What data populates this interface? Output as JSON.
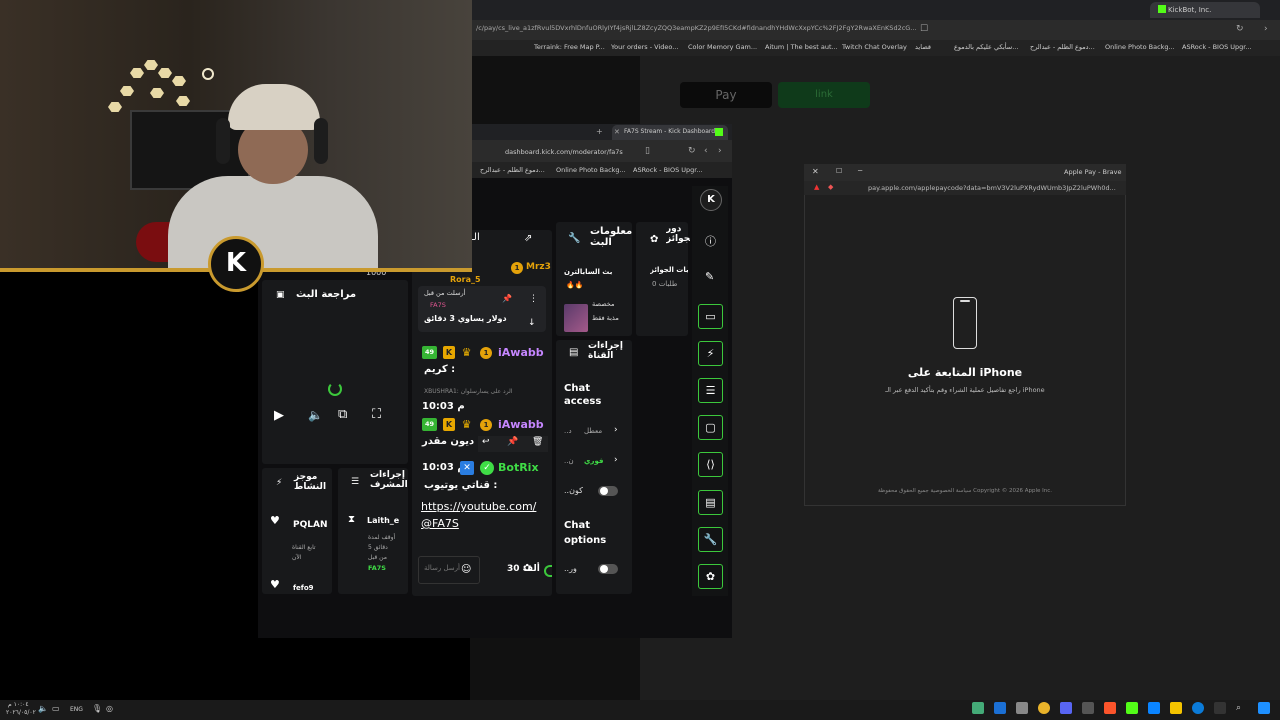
{
  "bg_browser": {
    "tab_label": "KickBot, Inc.",
    "url": "/c/pay/cs_live_a1zfRvul5DVxrhlDnfuORlyIYf4jsRjlLZ8ZcyZQQ3eampKZ2p9EfI5CKd#fidnandhYHdWcXxpYCc%2FJ2FgY2RwaXEnKSd2cG...",
    "bookmarks": [
      "Terraink: Free Map P...",
      "Your orders - Video...",
      "Color Memory Gam...",
      "Aitum | The best aut...",
      "Twitch Chat Overlay",
      "قصايد",
      "سأبكي عليكم بالدموع...",
      "دموع الظلم - عبدالرح...",
      "Online Photo Backg...",
      "ASRock - BIOS Upgr..."
    ],
    "apple_pay_label": " Pay",
    "link_label": "link"
  },
  "apple_pay_popup": {
    "title": "Apple Pay - Brave",
    "url": "pay.apple.com/applepaycode?data=bmV3V2luPXRydWUmb3JpZ2luPWh0d...",
    "heading": "المتابعة على iPhone",
    "subtitle": "راجع تفاصيل عملية الشراء وقم بتأكيد الدفع عبر الـ iPhone",
    "footer": "سياسة الخصوصية  جميع الحقوق محفوظة Copyright © 2026 Apple Inc."
  },
  "dashboard": {
    "tab_label": "FA7S Stream - Kick Dashboard",
    "url": "dashboard.kick.com/moderator/fa7s",
    "bookmarks": [
      "دموع الظلم - عبدالرح...",
      "Online Photo Backg...",
      "ASRock - BIOS Upgr..."
    ],
    "stream_review_title": "مراجعة البث",
    "stream_info_title": "معلومات البث",
    "channel_actions_title": "إجراءات القناة",
    "mod_actions_title": "إجراءات المشرف",
    "activity_title": "موجز النشاط",
    "rewards_title": "دور الجوائز",
    "rewards_sub": "طلبات الجوائز",
    "rewards_count": "طلبات 0",
    "stream_desc_line1": "بث السابالترن",
    "stream_desc_line2": "🔥🔥",
    "thumbnail_caption_1": "مخصصة",
    "thumbnail_caption_2": "مذبة فقط",
    "pinned_header": "أرسلت من قبل",
    "pinned_user": "FA7S",
    "pinned_text": "دولار يساوي 3 دقائق",
    "top_user_1": "Mrz3",
    "top_user_2": "Rora_5",
    "top_fragment": "الـ",
    "counter": "1000",
    "messages": [
      {
        "badge": "49",
        "user": "iAwabb",
        "text": "كريم :"
      },
      {
        "reply": "XBUSHRA1: الرد على يسارسلوان",
        "time": "10:03 م",
        "badge": "49",
        "user": "iAwabb",
        "text": "ديون مقدر :"
      },
      {
        "time": "10:03 م",
        "user": "BotRix",
        "text": "قناتي يوتيوب :",
        "link": "https://youtube.com/@FA7S"
      }
    ],
    "chat_input_placeholder": "أرسل رسالة",
    "viewer_count": "30 ألف",
    "chat_access_label": "Chat access",
    "chat_access_value": "معطل",
    "chat_access_prefix": "..د",
    "fast_value": "فوري",
    "fast_prefix": "..ن",
    "follow_label": "..كون",
    "chat_options_label": "Chat options",
    "emote_label": "..ور",
    "mod_user": "Laith_e",
    "mod_action_1": "أوقف لمدة",
    "mod_action_2": "5 دقائق",
    "mod_action_3": "من قبل",
    "mod_action_by": "FA7S",
    "activity_user": "PQLAN",
    "activity_line_1": "تابع القناة",
    "activity_line_2": "الآن",
    "activity_user_2": "fefo9"
  },
  "taskbar": {
    "clock_time": "١٠:٠٤ م",
    "clock_date": "٢٠٢٦/٠٥/٠٢",
    "language": "ENG"
  },
  "colors": {
    "kick_green": "#53fc18",
    "accent_green": "#3cc83c",
    "purple_user": "#c586ff",
    "gold": "#c99a2e"
  }
}
